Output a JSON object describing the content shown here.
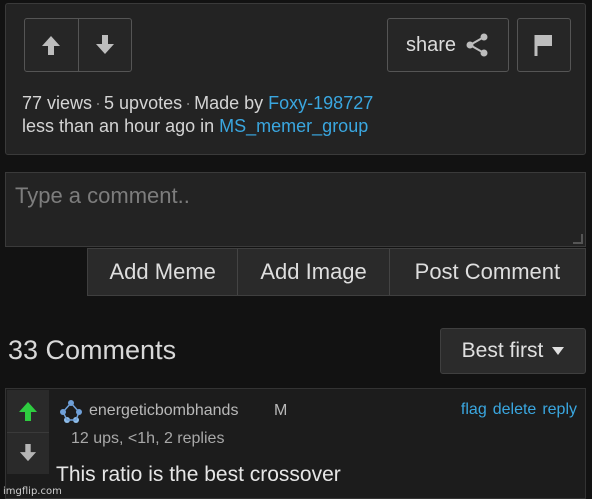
{
  "post": {
    "share_label": "share",
    "views": "77 views",
    "upvotes": "5 upvotes",
    "made_by_prefix": "Made by",
    "author": "Foxy-198727",
    "time_prefix": "less than an hour ago in",
    "group": "MS_memer_group"
  },
  "comment_form": {
    "placeholder": "Type a comment..",
    "add_meme": "Add Meme",
    "add_image": "Add Image",
    "post_comment": "Post Comment"
  },
  "comments": {
    "count_label": "33 Comments",
    "sort_label": "Best first",
    "items": [
      {
        "user": "energeticbombhands",
        "badge": "M",
        "stats": "12 ups, <1h, 2 replies",
        "text": "This ratio is the best crossover",
        "actions": [
          "flag",
          "delete",
          "reply"
        ]
      }
    ]
  },
  "watermark": "imgflip.com",
  "colors": {
    "link": "#3aa7e0",
    "upvote_active": "#2ecc40",
    "background": "#121212"
  },
  "icons": [
    "arrow-up-icon",
    "arrow-down-icon",
    "share-icon",
    "flag-icon",
    "caret-down-icon",
    "avatar-icon"
  ]
}
